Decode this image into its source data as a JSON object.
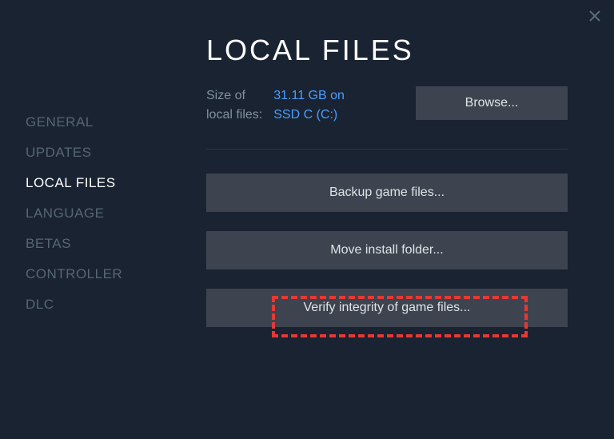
{
  "sidebar": {
    "items": [
      {
        "label": "GENERAL"
      },
      {
        "label": "UPDATES"
      },
      {
        "label": "LOCAL FILES"
      },
      {
        "label": "LANGUAGE"
      },
      {
        "label": "BETAS"
      },
      {
        "label": "CONTROLLER"
      },
      {
        "label": "DLC"
      }
    ],
    "active_index": 2
  },
  "main": {
    "title": "LOCAL FILES",
    "size_label_line1": "Size of",
    "size_label_line2": "local files:",
    "size_value_line1": "31.11 GB on",
    "size_value_line2": "SSD C (C:)",
    "browse_label": "Browse...",
    "backup_label": "Backup game files...",
    "move_label": "Move install folder...",
    "verify_label": "Verify integrity of game files..."
  }
}
